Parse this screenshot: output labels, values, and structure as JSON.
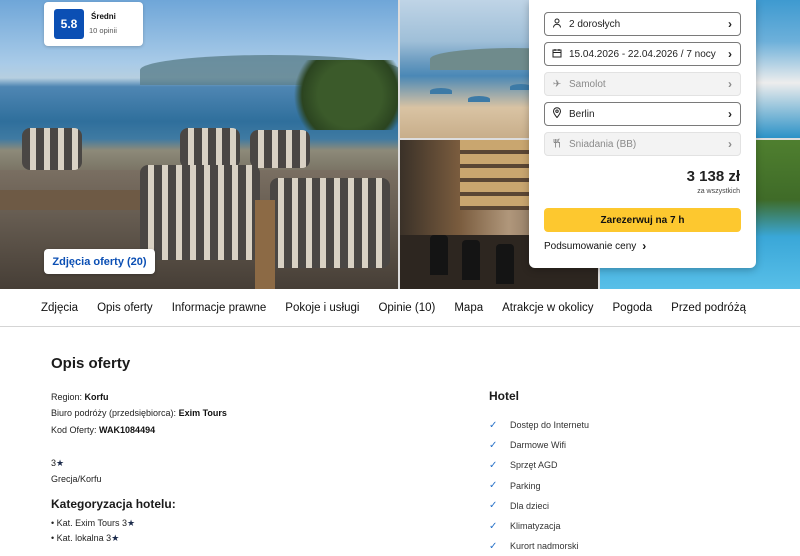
{
  "rating": {
    "score": "5.8",
    "label": "Średni",
    "count": "10 opinii"
  },
  "gallery": {
    "photos_button": "Zdjęcia oferty (20)"
  },
  "booking": {
    "travelers": "2 dorosłych",
    "dates": "15.04.2026 - 22.04.2026 / 7 nocy",
    "transport": "Samolot",
    "departure": "Berlin",
    "board": "Śniadania (BB)",
    "price": "3 138 zł",
    "price_note": "za wszystkich",
    "book_button": "Zarezerwuj na 7 h",
    "summary_link": "Podsumowanie ceny"
  },
  "nav": [
    "Zdjęcia",
    "Opis oferty",
    "Informacje prawne",
    "Pokoje i usługi",
    "Opinie (10)",
    "Mapa",
    "Atrakcje w okolicy",
    "Pogoda",
    "Przed podróżą"
  ],
  "offer": {
    "title": "Opis oferty",
    "region_label": "Region:",
    "region": "Korfu",
    "agency_label": "Biuro podróży (przedsiębiorca):",
    "agency": "Exim Tours",
    "code_label": "Kod Oferty:",
    "code": "WAK1084494",
    "stars": "3",
    "location": "Grecja/Korfu",
    "categorization_title": "Kategoryzacja hotelu:",
    "cat_exim": "• Kat. Exim Tours 3",
    "cat_local": "• Kat. lokalna 3"
  },
  "hotel": {
    "title": "Hotel",
    "amenities": [
      "Dostęp do Internetu",
      "Darmowe Wifi",
      "Sprzęt AGD",
      "Parking",
      "Dla dzieci",
      "Klimatyzacja",
      "Kurort nadmorski"
    ]
  }
}
